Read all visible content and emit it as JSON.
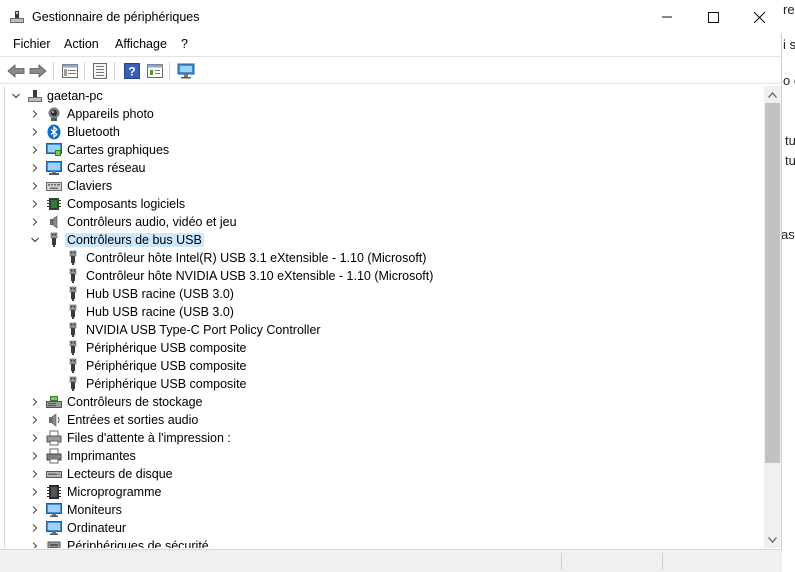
{
  "window": {
    "title": "Gestionnaire de périphériques"
  },
  "menu": [
    "Fichier",
    "Action",
    "Affichage",
    "?"
  ],
  "toolbar": {
    "icons": [
      "back-arrow-icon",
      "forward-arrow-icon",
      "properties-icon",
      "list-view-icon",
      "help-icon",
      "resources-icon",
      "scan-hardware-icon"
    ]
  },
  "tree": {
    "root": "gaetan-pc",
    "categories": [
      {
        "label": "Appareils photo",
        "icon": "camera-icon",
        "expanded": false
      },
      {
        "label": "Bluetooth",
        "icon": "bluetooth-icon",
        "expanded": false
      },
      {
        "label": "Cartes graphiques",
        "icon": "display-adapter-icon",
        "expanded": false
      },
      {
        "label": "Cartes réseau",
        "icon": "network-adapter-icon",
        "expanded": false
      },
      {
        "label": "Claviers",
        "icon": "keyboard-icon",
        "expanded": false
      },
      {
        "label": "Composants logiciels",
        "icon": "software-component-icon",
        "expanded": false
      },
      {
        "label": "Contrôleurs audio, vidéo et jeu",
        "icon": "speaker-icon",
        "expanded": false
      },
      {
        "label": "Contrôleurs de bus USB",
        "icon": "usb-icon",
        "expanded": true,
        "selected": true,
        "children": [
          "Contrôleur hôte Intel(R) USB 3.1 eXtensible - 1.10 (Microsoft)",
          "Contrôleur hôte NVIDIA USB 3.10 eXtensible - 1.10 (Microsoft)",
          "Hub USB racine (USB 3.0)",
          "Hub USB racine (USB 3.0)",
          "NVIDIA USB Type-C Port Policy Controller",
          "Périphérique USB composite",
          "Périphérique USB composite",
          "Périphérique USB composite"
        ]
      },
      {
        "label": "Contrôleurs de stockage",
        "icon": "storage-controller-icon",
        "expanded": false
      },
      {
        "label": "Entrées et sorties audio",
        "icon": "audio-io-icon",
        "expanded": false
      },
      {
        "label": "Files d'attente à l'impression :",
        "icon": "print-queue-icon",
        "expanded": false
      },
      {
        "label": "Imprimantes",
        "icon": "printer-icon",
        "expanded": false
      },
      {
        "label": "Lecteurs de disque",
        "icon": "disk-drive-icon",
        "expanded": false
      },
      {
        "label": "Microprogramme",
        "icon": "firmware-icon",
        "expanded": false
      },
      {
        "label": "Moniteurs",
        "icon": "monitor-icon",
        "expanded": false
      },
      {
        "label": "Ordinateur",
        "icon": "computer-icon",
        "expanded": false
      },
      {
        "label": "Périphériques de sécurité",
        "icon": "security-device-icon",
        "expanded": false
      }
    ]
  },
  "background_text": [
    "re",
    "i s",
    "o c",
    "tu",
    "tu",
    "as"
  ],
  "colors": {
    "selection": "#cce8ff",
    "scroll_thumb": "#c2c2c2",
    "status_bar": "#f0f0f0"
  }
}
